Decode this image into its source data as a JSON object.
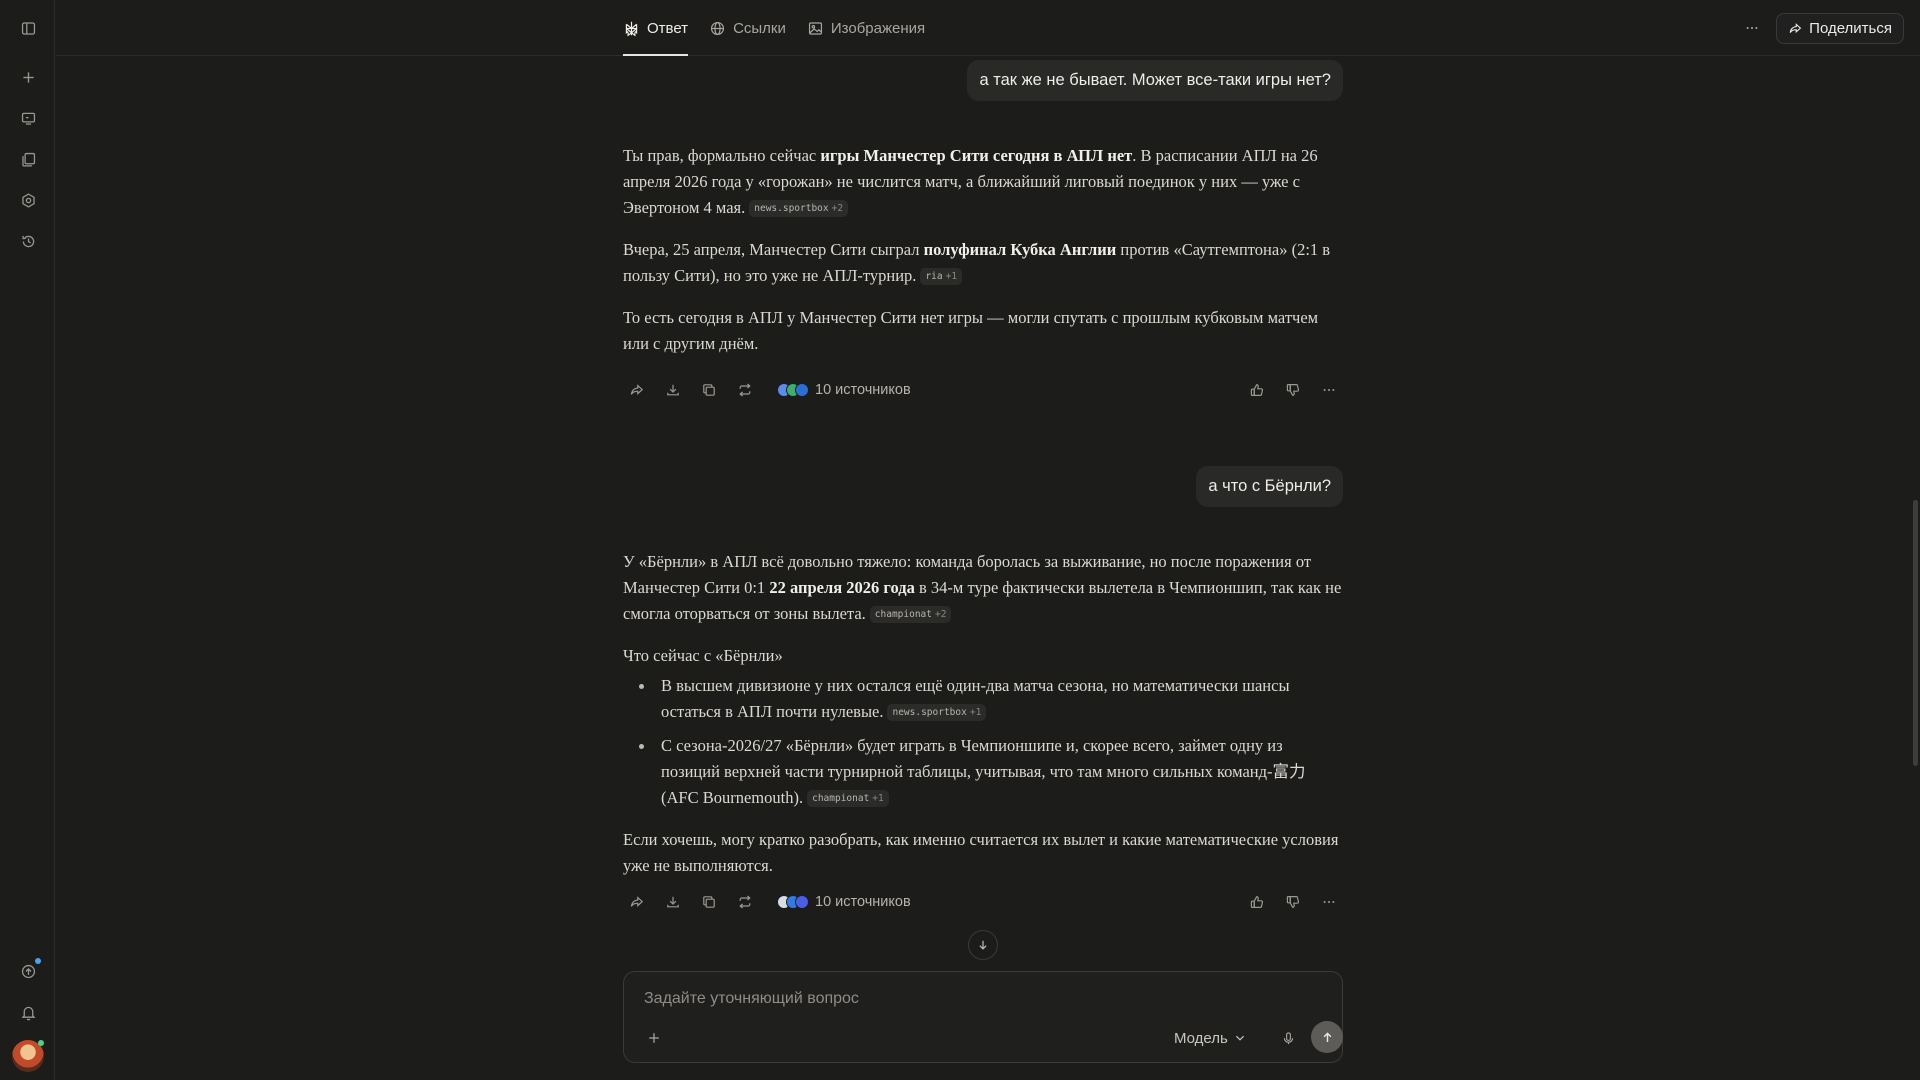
{
  "tabs": [
    {
      "label": "Ответ",
      "icon": "perplexity-logo-icon",
      "active": true
    },
    {
      "label": "Ссылки",
      "icon": "globe-icon",
      "active": false
    },
    {
      "label": "Изображения",
      "icon": "image-icon",
      "active": false
    }
  ],
  "header": {
    "share_label": "Поделиться"
  },
  "thread": {
    "q1": "а так же не бывает. Может все-таки игры нет?",
    "a1": {
      "p1": {
        "t1": "Ты прав, формально сейчас ",
        "b1": "игры Манчестер Сити сегодня в АПЛ нет",
        "t2": ". В расписании АПЛ на 26 апреля 2026 года у «горожан» не числится матч, а ближайший лиговый поединок у них — уже с Эвертоном 4 мая.",
        "cite": {
          "source": "news.sportbox",
          "more": "+2"
        }
      },
      "p2": {
        "t1": "Вчера, 25 апреля, Манчестер Сити сыграл ",
        "b1": "полуфинал Кубка Англии",
        "t2": " против «Саутгемптона» (2:1 в пользу Сити), но это уже не АПЛ-турнир.",
        "cite": {
          "source": "ria",
          "more": "+1"
        }
      },
      "p3": "То есть сегодня в АПЛ у Манчестер Сити нет игры — могли спутать с прошлым кубковым матчем или с другим днём.",
      "sources_label": "10 источников"
    },
    "q2": "а что с Бёрнли?",
    "a2": {
      "p1": {
        "t1": "У «Бёрнли» в АПЛ всё довольно тяжело: команда боролась за выживание, но после поражения от Манчестер Сити 0:1 ",
        "b1": "22 апреля 2026 года",
        "t2": " в 34‑м туре фактически вылетела в Чемпионшип, так как не смогла оторваться от зоны вылета.",
        "cite": {
          "source": "championat",
          "more": "+2"
        }
      },
      "subhead": "Что сейчас с «Бёрнли»",
      "bullets": [
        {
          "text": "В высшем дивизионе у них остался ещё один‑два матча сезона, но математически шансы остаться в АПЛ почти нулевые.",
          "cite": {
            "source": "news.sportbox",
            "more": "+1"
          }
        },
        {
          "text": "С сезона‑2026/27 «Бёрнли» будет играть в Чемпионшипе и, скорее всего, займет одну из позиций верхней части турнирной таблицы, учитывая, что там много сильных команд‑富力 (AFC Bournemouth).",
          "cite": {
            "source": "championat",
            "more": "+1"
          }
        }
      ],
      "p3": "Если хочешь, могу кратко разобрать, как именно считается их вылет и какие математические условия уже не выполняются.",
      "sources_label": "10 источников"
    }
  },
  "composer": {
    "placeholder": "Задайте уточняющий вопрос",
    "value": "",
    "model_label": "Модель"
  },
  "icons": {
    "rail": [
      "sidebar-toggle-icon",
      "new-thread-icon",
      "computer-icon",
      "library-icon",
      "spaces-icon",
      "history-icon",
      "upgrade-icon",
      "bell-icon"
    ],
    "actions": [
      "share-icon",
      "download-icon",
      "copy-icon",
      "rewrite-icon",
      "thumbs-up-icon",
      "thumbs-down-icon",
      "more-icon"
    ]
  },
  "colors": {
    "background": "#1c1c1b",
    "bubble": "#292927",
    "text": "#dcd9d3",
    "badge": "#4aa3f0",
    "avatar_badge": "#4fd18b"
  }
}
